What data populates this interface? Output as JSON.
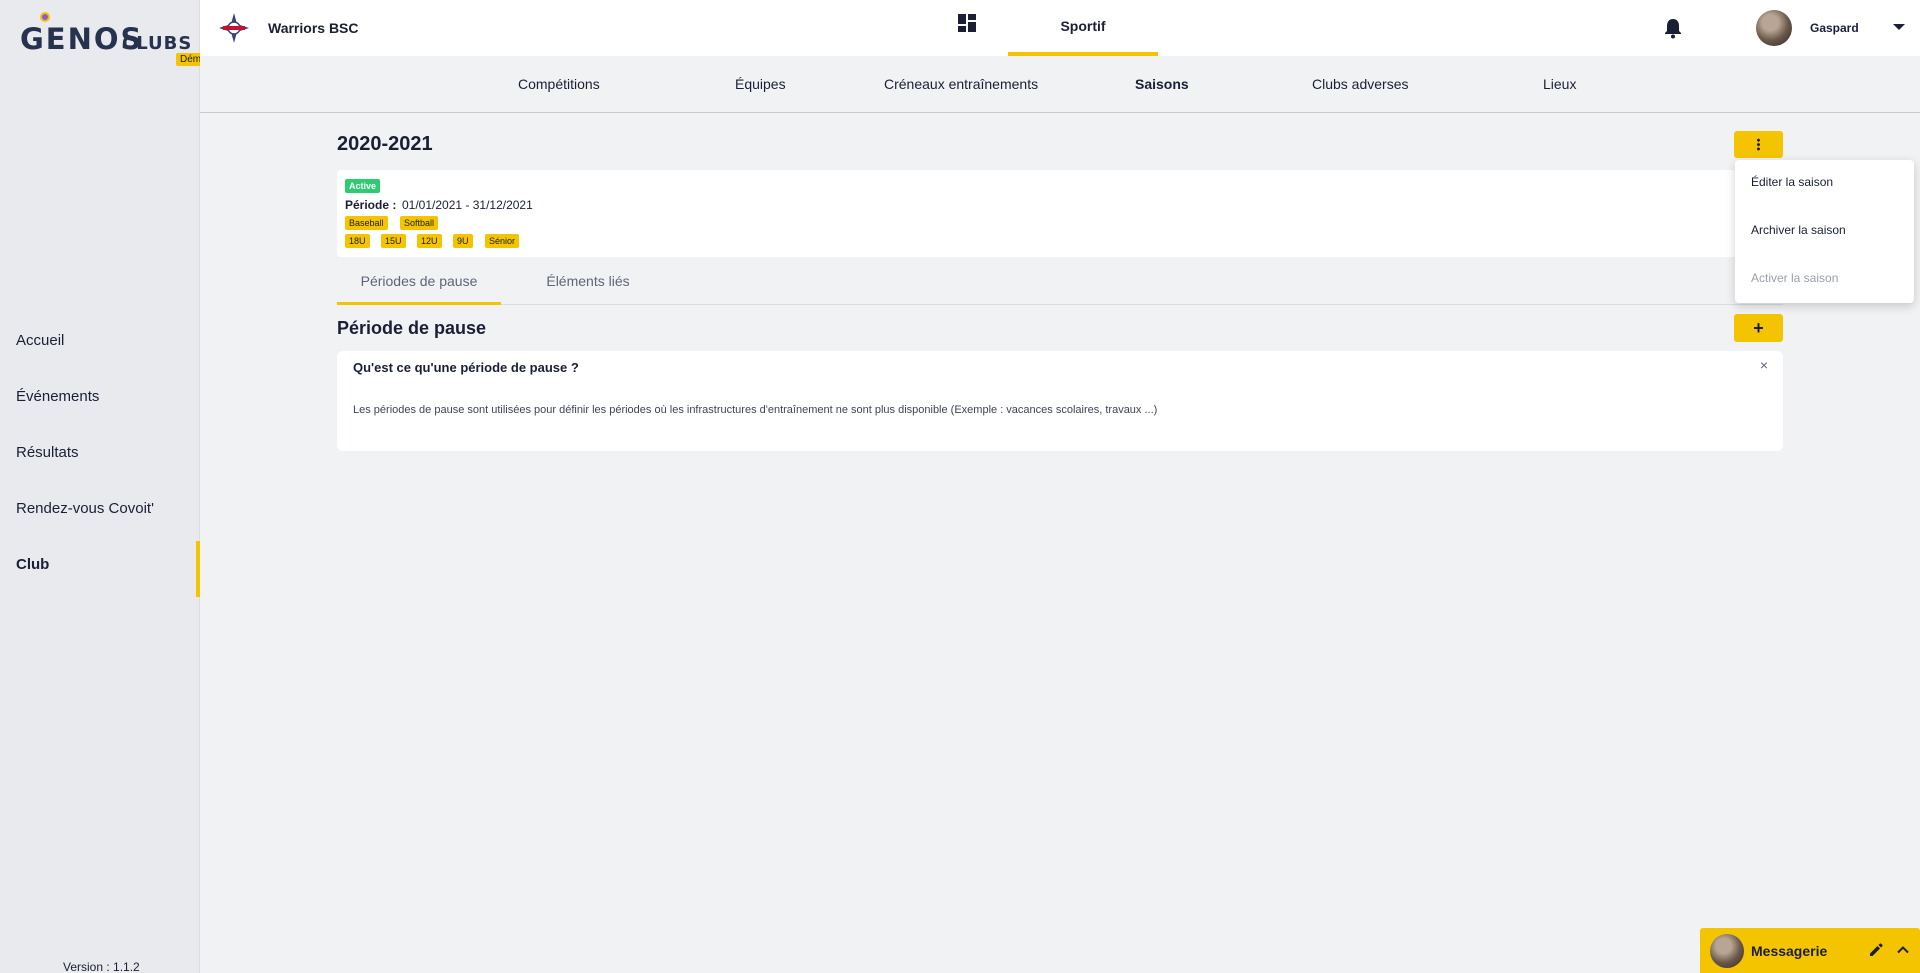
{
  "brand": {
    "name": "GENOS",
    "suffix": "CLUBS",
    "badge": "Démo",
    "version": "Version : 1.1.2"
  },
  "sidebar": {
    "items": [
      {
        "label": "Accueil"
      },
      {
        "label": "Événements"
      },
      {
        "label": "Résultats"
      },
      {
        "label": "Rendez-vous Covoit'"
      },
      {
        "label": "Club"
      }
    ],
    "active": "Club"
  },
  "topbar": {
    "club_name": "Warriors BSC",
    "active_section": "Sportif",
    "user_name": "Gaspard",
    "icons": [
      "dashboard-icon",
      "bell-icon",
      "caret-down-icon"
    ]
  },
  "subnav": {
    "items": [
      {
        "label": "Compétitions"
      },
      {
        "label": "Équipes"
      },
      {
        "label": "Créneaux entraînements"
      },
      {
        "label": "Saisons"
      },
      {
        "label": "Clubs adverses"
      },
      {
        "label": "Lieux"
      }
    ],
    "active": "Saisons"
  },
  "season": {
    "title": "2020-2021",
    "status": "Active",
    "period_label": "Période :",
    "period_value": "01/01/2021 - 31/12/2021",
    "sports": [
      "Baseball",
      "Softball"
    ],
    "categories": [
      "18U",
      "15U",
      "12U",
      "9U",
      "Sénior"
    ]
  },
  "tabs": {
    "items": [
      {
        "label": "Périodes de pause"
      },
      {
        "label": "Éléments liés"
      }
    ],
    "active": "Périodes de pause"
  },
  "section": {
    "title": "Période de pause",
    "add_label": "+"
  },
  "help": {
    "title": "Qu'est ce qu'une période de pause ?",
    "close": "×",
    "text": "Les périodes de pause sont utilisées pour définir les périodes où les infrastructures d'entraînement ne sont plus disponible (Exemple : vacances scolaires, travaux ...)"
  },
  "menu": {
    "items": [
      {
        "label": "Éditer la saison",
        "enabled": true
      },
      {
        "label": "Archiver la saison",
        "enabled": true
      },
      {
        "label": "Activer la saison",
        "enabled": false
      }
    ]
  },
  "messenger": {
    "label": "Messagerie"
  },
  "colors": {
    "accent": "#f5c400",
    "active_badge": "#2ecc71",
    "text": "#1a1f36",
    "sidebar_bg": "#e9eaed",
    "page_bg": "#f1f2f4"
  }
}
